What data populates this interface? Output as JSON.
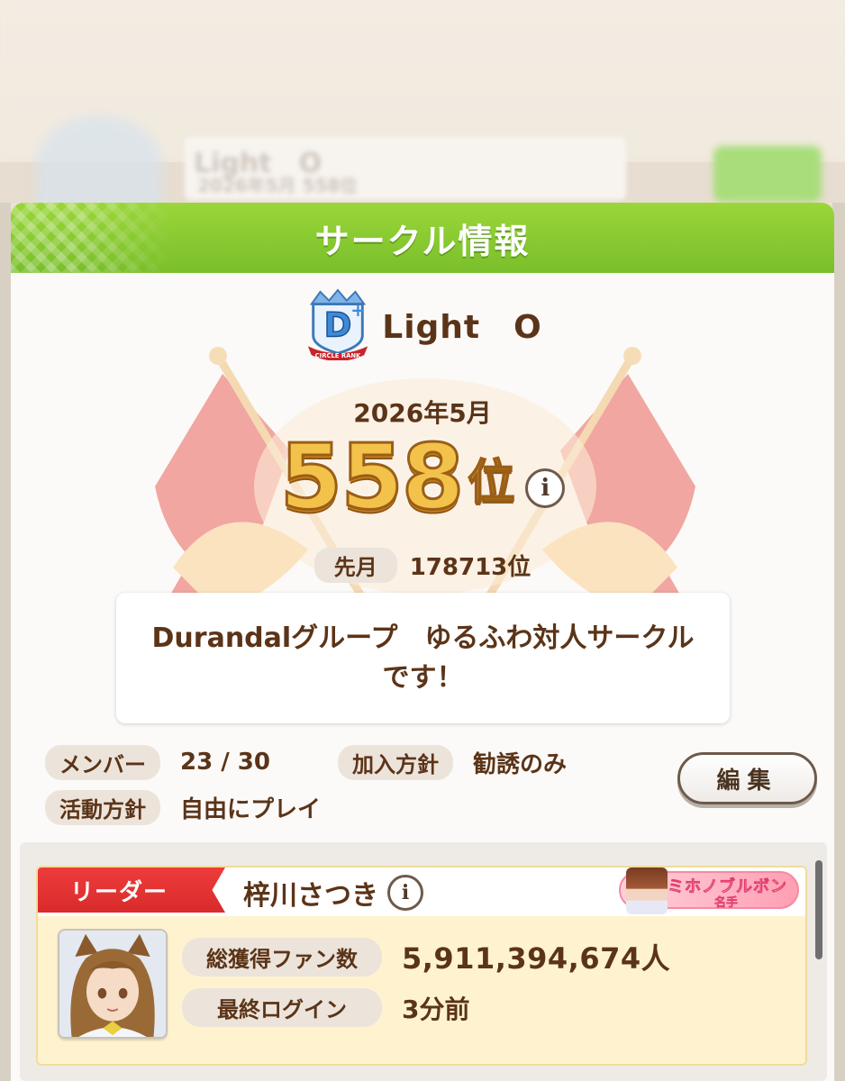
{
  "background": {
    "circle_name": "Light　O",
    "date_text": "2026年5月 558位"
  },
  "dialog": {
    "title": "サークル情報"
  },
  "circle": {
    "rank_badge": "D+",
    "rank_badge_caption": "CIRCLE RANK",
    "name": "Light　O",
    "month": "2026年5月",
    "rank_number": "558",
    "rank_suffix": "位",
    "info_glyph": "i",
    "prev_label": "先月",
    "prev_value": "178713位",
    "description": "Durandalグループ　ゆるふわ対人サークル\nです！",
    "member_label": "メンバー",
    "member_value": "23 / 30",
    "join_label": "加入方針",
    "join_value": "勧誘のみ",
    "activity_label": "活動方針",
    "activity_value": "自由にプレイ",
    "edit_button": "編集"
  },
  "leader": {
    "tag": "リーダー",
    "name": "梓川さつき",
    "title_main": "ミホノブルボン",
    "title_sub": "名手",
    "fans_label": "総獲得ファン数",
    "fans_value": "5,911,394,674人",
    "login_label": "最終ログイン",
    "login_value": "3分前"
  },
  "colors": {
    "header_green": "#79bf2a",
    "text_brown": "#5b3418",
    "leader_red": "#d92b2b",
    "card_yellow": "#fff3cf",
    "rank_gold": "#f2c24a"
  },
  "icons": [
    "circle-rank-badge-icon",
    "info-icon",
    "flag-crest-decoration",
    "sparkle-icon"
  ]
}
